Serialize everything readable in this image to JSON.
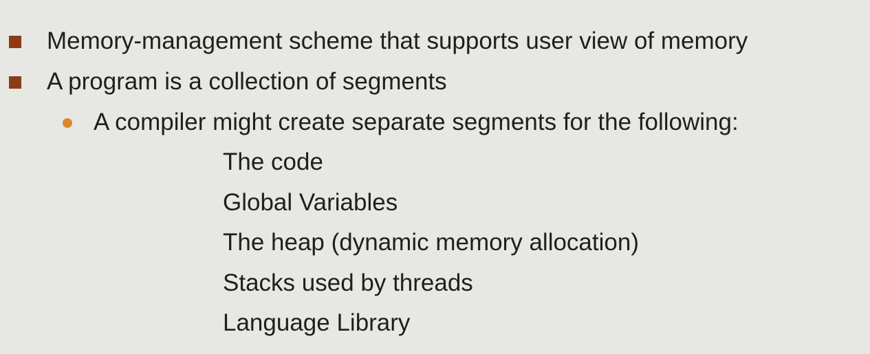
{
  "bullets": [
    {
      "text": "Memory-management scheme that supports user view of memory"
    },
    {
      "text": "A program is a collection of segments"
    }
  ],
  "sub_bullet": {
    "text": "A compiler might create separate segments for the following:"
  },
  "segments": [
    "The code",
    "Global Variables",
    "The heap (dynamic memory allocation)",
    "Stacks used by threads",
    "Language Library"
  ],
  "colors": {
    "background": "#e7e8e3",
    "square_bullet": "#8c3a17",
    "round_bullet": "#d8892c",
    "text": "#1f1f1f"
  }
}
